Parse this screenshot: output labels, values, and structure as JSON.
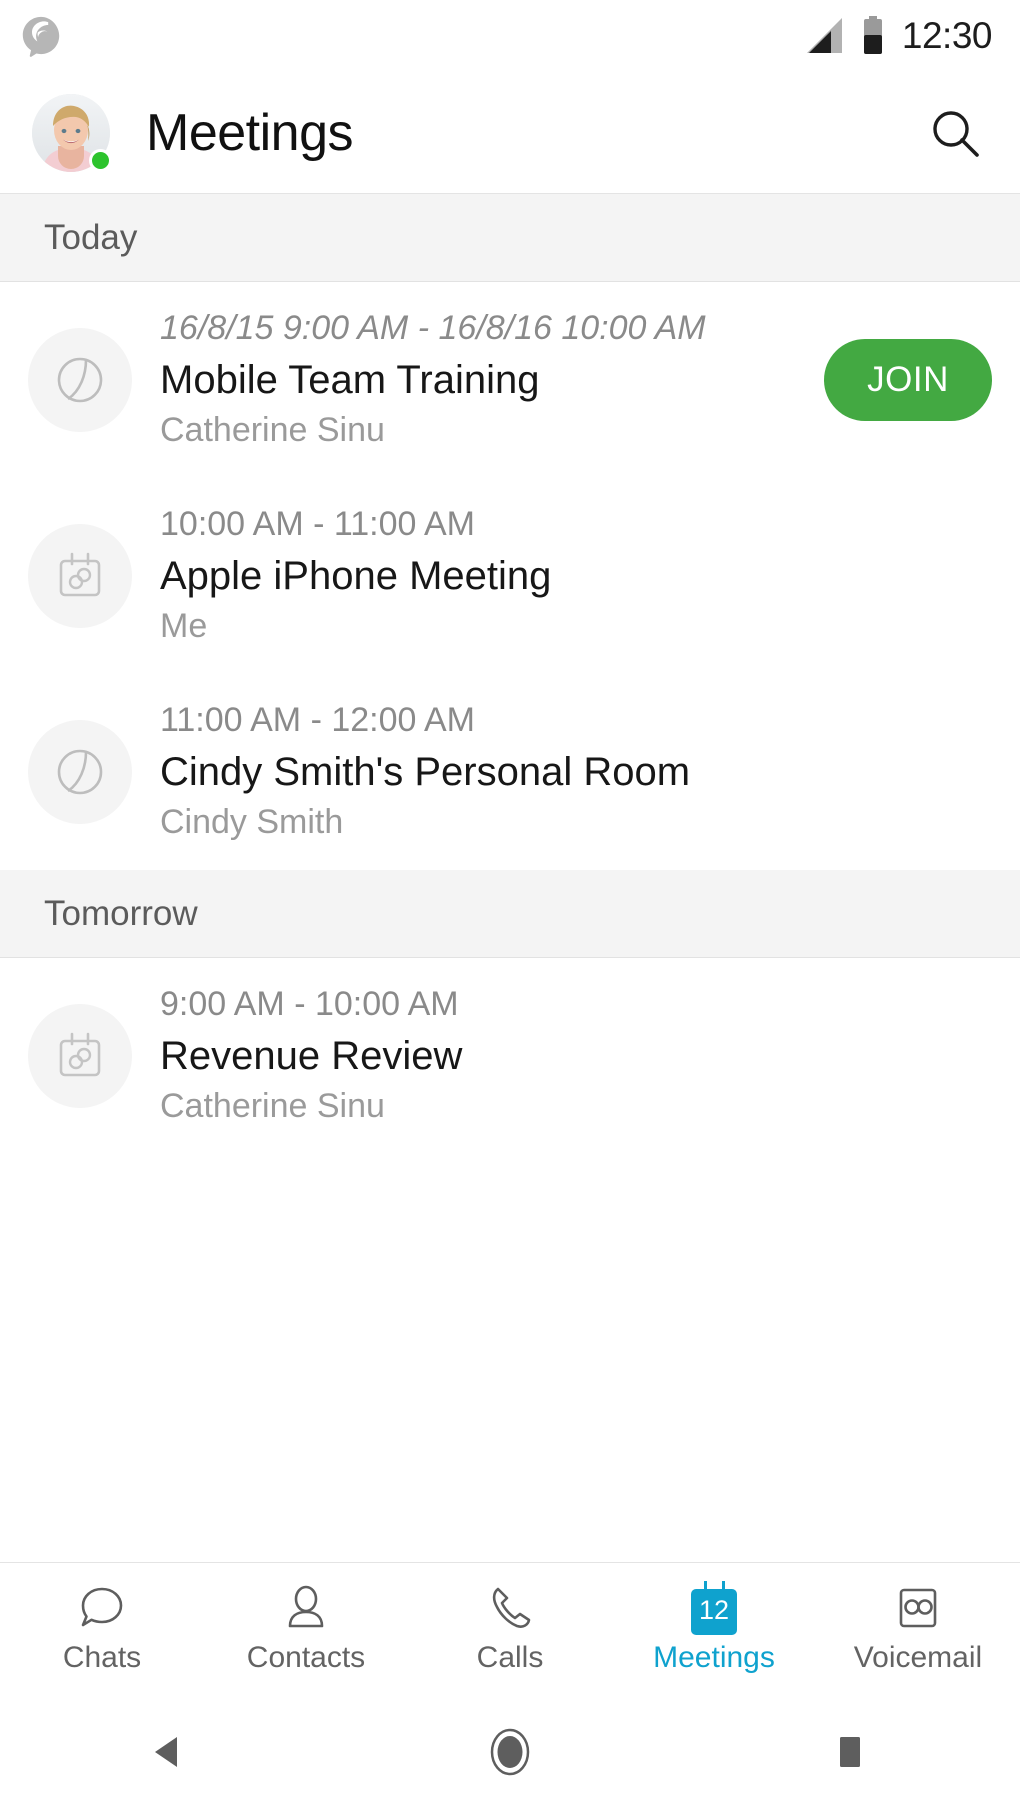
{
  "status_bar": {
    "app_icon": "spark-logo-icon",
    "signal_icon": "cellular-signal-icon",
    "battery_icon": "battery-half-icon",
    "clock": "12:30"
  },
  "app_bar": {
    "avatar": "user-avatar",
    "presence": "online-status-dot",
    "title": "Meetings",
    "search_icon": "search-icon"
  },
  "sections": [
    {
      "label": "Today",
      "meetings": [
        {
          "icon": "personal-room-icon",
          "time": "16/8/15 9:00 AM - 16/8/16 10:00 AM",
          "time_italic": true,
          "title": "Mobile Team Training",
          "host": "Catherine Sinu",
          "has_join": true,
          "join_label": "JOIN"
        },
        {
          "icon": "calendar-link-icon",
          "time": "10:00 AM - 11:00 AM",
          "time_italic": false,
          "title": "Apple iPhone Meeting",
          "host": "Me",
          "has_join": false,
          "join_label": ""
        },
        {
          "icon": "personal-room-icon",
          "time": "11:00 AM - 12:00 AM",
          "time_italic": false,
          "title": "Cindy Smith's Personal Room",
          "host": "Cindy Smith",
          "has_join": false,
          "join_label": ""
        }
      ]
    },
    {
      "label": "Tomorrow",
      "meetings": [
        {
          "icon": "calendar-link-icon",
          "time": "9:00 AM - 10:00 AM",
          "time_italic": false,
          "title": "Revenue Review",
          "host": "Catherine Sinu",
          "has_join": false,
          "join_label": ""
        }
      ]
    }
  ],
  "tab_bar": {
    "active_index": 3,
    "tabs": [
      {
        "label": "Chats",
        "icon": "chat-bubble-icon"
      },
      {
        "label": "Contacts",
        "icon": "person-icon"
      },
      {
        "label": "Calls",
        "icon": "phone-handset-icon"
      },
      {
        "label": "Meetings",
        "icon": "calendar-icon",
        "badge": "12"
      },
      {
        "label": "Voicemail",
        "icon": "voicemail-icon"
      }
    ]
  },
  "nav_bar": {
    "back": "back-triangle-icon",
    "home": "home-circle-icon",
    "recents": "recents-square-icon"
  },
  "colors": {
    "accent_blue": "#0fa2ce",
    "join_green": "#43a942",
    "presence_green": "#2dc32d",
    "section_bg": "#f4f4f4"
  }
}
